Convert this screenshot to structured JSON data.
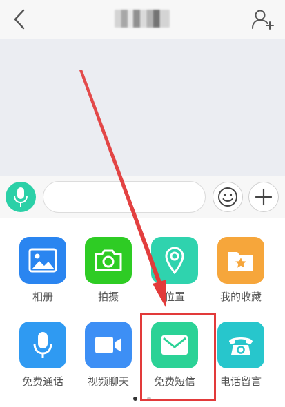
{
  "header": {
    "title": "",
    "back_icon": "chevron-left-icon",
    "add_friend_icon": "add-user-icon"
  },
  "input_bar": {
    "message_value": "",
    "message_placeholder": ""
  },
  "panel": {
    "items": [
      {
        "label": "相册",
        "icon": "photo-icon",
        "color": "#2a85f0"
      },
      {
        "label": "拍摄",
        "icon": "camera-icon",
        "color": "#2ecc24"
      },
      {
        "label": "位置",
        "icon": "location-pin-icon",
        "color": "#2fd3ae"
      },
      {
        "label": "我的收藏",
        "icon": "star-folder-icon",
        "color": "#f6a63b"
      },
      {
        "label": "免费通话",
        "icon": "microphone-icon",
        "color": "#2f9af2"
      },
      {
        "label": "视频聊天",
        "icon": "video-camera-icon",
        "color": "#3d8ff5"
      },
      {
        "label": "免费短信",
        "icon": "envelope-icon",
        "color": "#2bd296"
      },
      {
        "label": "电话留言",
        "icon": "telephone-icon",
        "color": "#27c6cc"
      }
    ],
    "page_indicator": {
      "pages": 2,
      "current": 1
    }
  },
  "colors": {
    "mic_button": "#2bd0a7",
    "annotation_red": "#e23a3a"
  }
}
